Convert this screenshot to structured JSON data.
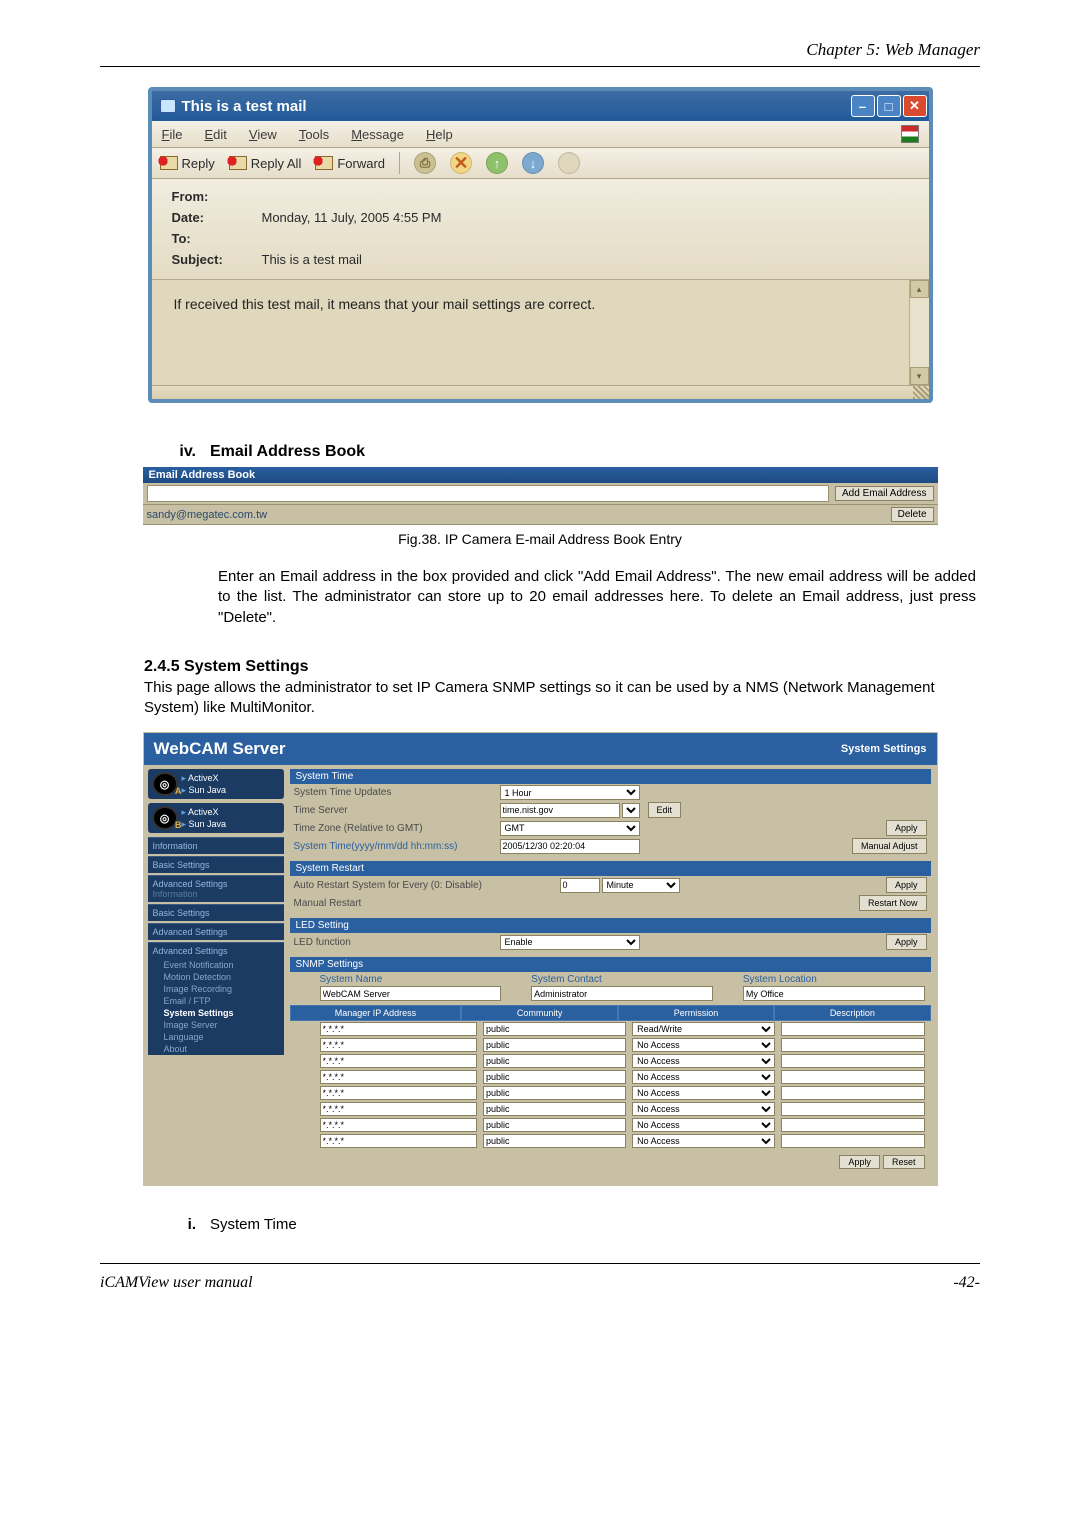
{
  "header": {
    "chapter": "Chapter 5: Web Manager"
  },
  "mail": {
    "title": "This is a test mail",
    "menu": {
      "file": "File",
      "edit": "Edit",
      "view": "View",
      "tools": "Tools",
      "message": "Message",
      "help": "Help"
    },
    "toolbar": {
      "reply": "Reply",
      "reply_all": "Reply All",
      "forward": "Forward"
    },
    "headers": {
      "from_label": "From:",
      "from": "",
      "date_label": "Date:",
      "date": "Monday, 11 July, 2005 4:55 PM",
      "to_label": "To:",
      "to": "",
      "subject_label": "Subject:",
      "subject": "This is a test mail"
    },
    "body": "If received this test mail, it means that your mail settings are correct."
  },
  "sec_iv": {
    "num": "iv.",
    "title": "Email Address Book"
  },
  "address_book": {
    "header": "Email Address Book",
    "add_btn": "Add Email Address",
    "email": "sandy@megatec.com.tw",
    "delete_btn": "Delete"
  },
  "fig38": "Fig.38.  IP Camera E-mail Address Book Entry",
  "para_iv": "Enter an Email address in the box provided and click \"Add Email Address\". The new email address will be added to the list.   The administrator can store up to 20 email addresses here.   To delete an Email address, just press \"Delete\".",
  "h245": "2.4.5 System Settings",
  "para_245": "This page allows the administrator to set IP Camera SNMP settings so it can be used by a NMS (Network Management System) like MultiMonitor.",
  "webcam": {
    "title": "WebCAM Server",
    "page_title": "System Settings",
    "sidebar": {
      "cams": [
        {
          "letter": "A",
          "activex": "ActiveX",
          "java": "Sun Java"
        },
        {
          "letter": "B",
          "activex": "ActiveX",
          "java": "Sun Java"
        }
      ],
      "items": [
        "Information",
        "Basic Settings",
        "Advanced Settings",
        "Information",
        "Basic Settings",
        "Advanced Settings",
        "Advanced Settings"
      ],
      "subs": [
        "Event Notification",
        "Motion Detection",
        "Image Recording",
        "Email / FTP",
        "System Settings",
        "Image Server",
        "Language",
        "About"
      ]
    },
    "system_time": {
      "title": "System Time",
      "rows": {
        "updates": {
          "label": "System Time Updates",
          "value": "1 Hour"
        },
        "server": {
          "label": "Time Server",
          "value": "time.nist.gov",
          "edit_btn": "Edit"
        },
        "zone": {
          "label": "Time Zone (Relative to GMT)",
          "value": "GMT",
          "apply_btn": "Apply"
        },
        "systime": {
          "label": "System Time(yyyy/mm/dd hh:mm:ss)",
          "value": "2005/12/30 02:20:04",
          "btn": "Manual Adjust"
        }
      }
    },
    "system_restart": {
      "title": "System Restart",
      "auto_label": "Auto Restart System for Every (0: Disable)",
      "auto_value": "0",
      "auto_unit": "Minute",
      "apply_btn": "Apply",
      "manual_label": "Manual Restart",
      "restart_btn": "Restart Now"
    },
    "led": {
      "title": "LED Setting",
      "row": {
        "label": "LED function",
        "value": "Enable",
        "apply_btn": "Apply"
      }
    },
    "snmp": {
      "title": "SNMP Settings",
      "fields": {
        "name": {
          "label": "System Name",
          "value": "WebCAM Server"
        },
        "contact": {
          "label": "System Contact",
          "value": "Administrator"
        },
        "location": {
          "label": "System Location",
          "value": "My Office"
        }
      },
      "cols": [
        "Manager IP Address",
        "Community",
        "Permission",
        "Description"
      ],
      "rows": [
        {
          "ip": "*.*.*.*",
          "community": "public",
          "permission": "Read/Write",
          "desc": ""
        },
        {
          "ip": "*.*.*.*",
          "community": "public",
          "permission": "No Access",
          "desc": ""
        },
        {
          "ip": "*.*.*.*",
          "community": "public",
          "permission": "No Access",
          "desc": ""
        },
        {
          "ip": "*.*.*.*",
          "community": "public",
          "permission": "No Access",
          "desc": ""
        },
        {
          "ip": "*.*.*.*",
          "community": "public",
          "permission": "No Access",
          "desc": ""
        },
        {
          "ip": "*.*.*.*",
          "community": "public",
          "permission": "No Access",
          "desc": ""
        },
        {
          "ip": "*.*.*.*",
          "community": "public",
          "permission": "No Access",
          "desc": ""
        },
        {
          "ip": "*.*.*.*",
          "community": "public",
          "permission": "No Access",
          "desc": ""
        }
      ],
      "apply_btn": "Apply",
      "reset_btn": "Reset"
    }
  },
  "sec_i": {
    "num": "i.",
    "title": "System Time"
  },
  "footer": {
    "left": "iCAMView user manual",
    "right": "-42-"
  }
}
